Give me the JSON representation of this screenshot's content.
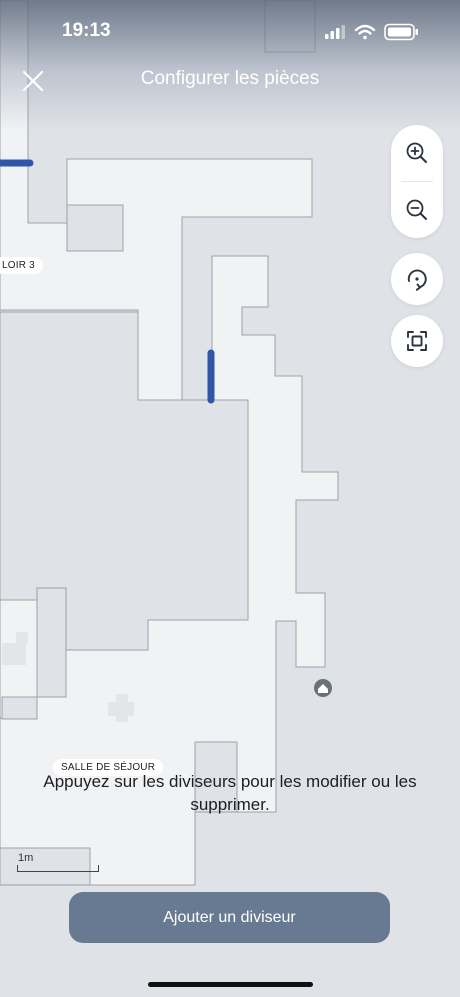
{
  "status_bar": {
    "time": "19:13",
    "icons": [
      "cellular-signal-icon",
      "wifi-icon",
      "battery-icon"
    ]
  },
  "nav": {
    "title": "Configurer les pièces",
    "close_icon": "close-icon"
  },
  "map_controls": [
    "zoom-in-icon",
    "zoom-out-icon",
    "rotate-icon",
    "fit-screen-icon"
  ],
  "rooms": {
    "corridor_label": "LOIR 3",
    "living_room_label": "SALLE DE SÉJOUR"
  },
  "dock_icon": "home-icon",
  "hint": "Appuyez sur les diviseurs pour les modifier ou les supprimer.",
  "scale": {
    "label": "1m"
  },
  "actions": {
    "add_divider": "Ajouter un diviseur"
  },
  "colors": {
    "floor": "#f1f2f4",
    "background": "#dfe2e7",
    "divider": "#2f57a9",
    "button": "#677a91"
  }
}
